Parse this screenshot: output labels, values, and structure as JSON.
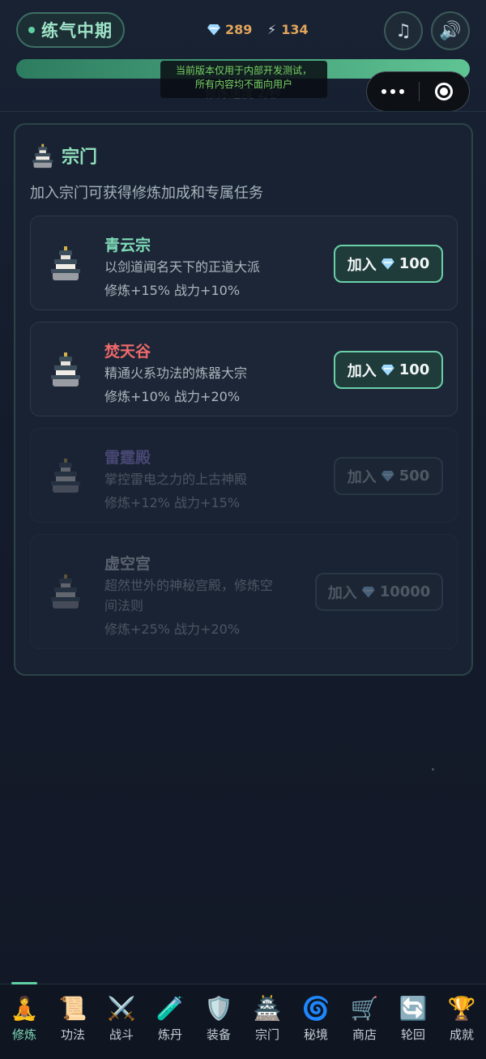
{
  "header": {
    "realm": "练气中期",
    "gems": "289",
    "energy": "134",
    "music_icon": "♫",
    "sound_icon": "🔊"
  },
  "progress": {
    "value_fraction": 1.0,
    "caption": "修炼速度 2/秒"
  },
  "notice": {
    "line1": "当前版本仅用于内部开发测试，",
    "line2": "所有内容均不面向用户"
  },
  "panel": {
    "title": "宗门",
    "subtitle": "加入宗门可获得修炼加成和专属任务",
    "join_label": "加入",
    "sects": [
      {
        "name": "青云宗",
        "name_color": "#7fdcb8",
        "desc": "以剑道闻名天下的正道大派",
        "bonus": "修炼+15% 战力+10%",
        "cost": "100",
        "locked": false
      },
      {
        "name": "焚天谷",
        "name_color": "#f06a6a",
        "desc": "精通火系功法的炼器大宗",
        "bonus": "修炼+10% 战力+20%",
        "cost": "100",
        "locked": false
      },
      {
        "name": "雷霆殿",
        "name_color": "#a48ef0",
        "desc": "掌控雷电之力的上古神殿",
        "bonus": "修炼+12% 战力+15%",
        "cost": "500",
        "locked": true
      },
      {
        "name": "虚空宫",
        "name_color": "#d8dee4",
        "desc_line1": "超然世外的神秘宫殿，修炼空",
        "desc_line2": "间法则",
        "bonus": "修炼+25% 战力+20%",
        "cost": "10000",
        "locked": true
      }
    ]
  },
  "nav": [
    {
      "icon": "🧘",
      "label": "修炼",
      "active": true
    },
    {
      "icon": "📜",
      "label": "功法"
    },
    {
      "icon": "⚔️",
      "label": "战斗"
    },
    {
      "icon": "🧪",
      "label": "炼丹"
    },
    {
      "icon": "🛡️",
      "label": "装备"
    },
    {
      "icon": "🏯",
      "label": "宗门"
    },
    {
      "icon": "🌀",
      "label": "秘境"
    },
    {
      "icon": "🛒",
      "label": "商店"
    },
    {
      "icon": "🔄",
      "label": "轮回"
    },
    {
      "icon": "🏆",
      "label": "成就"
    }
  ]
}
